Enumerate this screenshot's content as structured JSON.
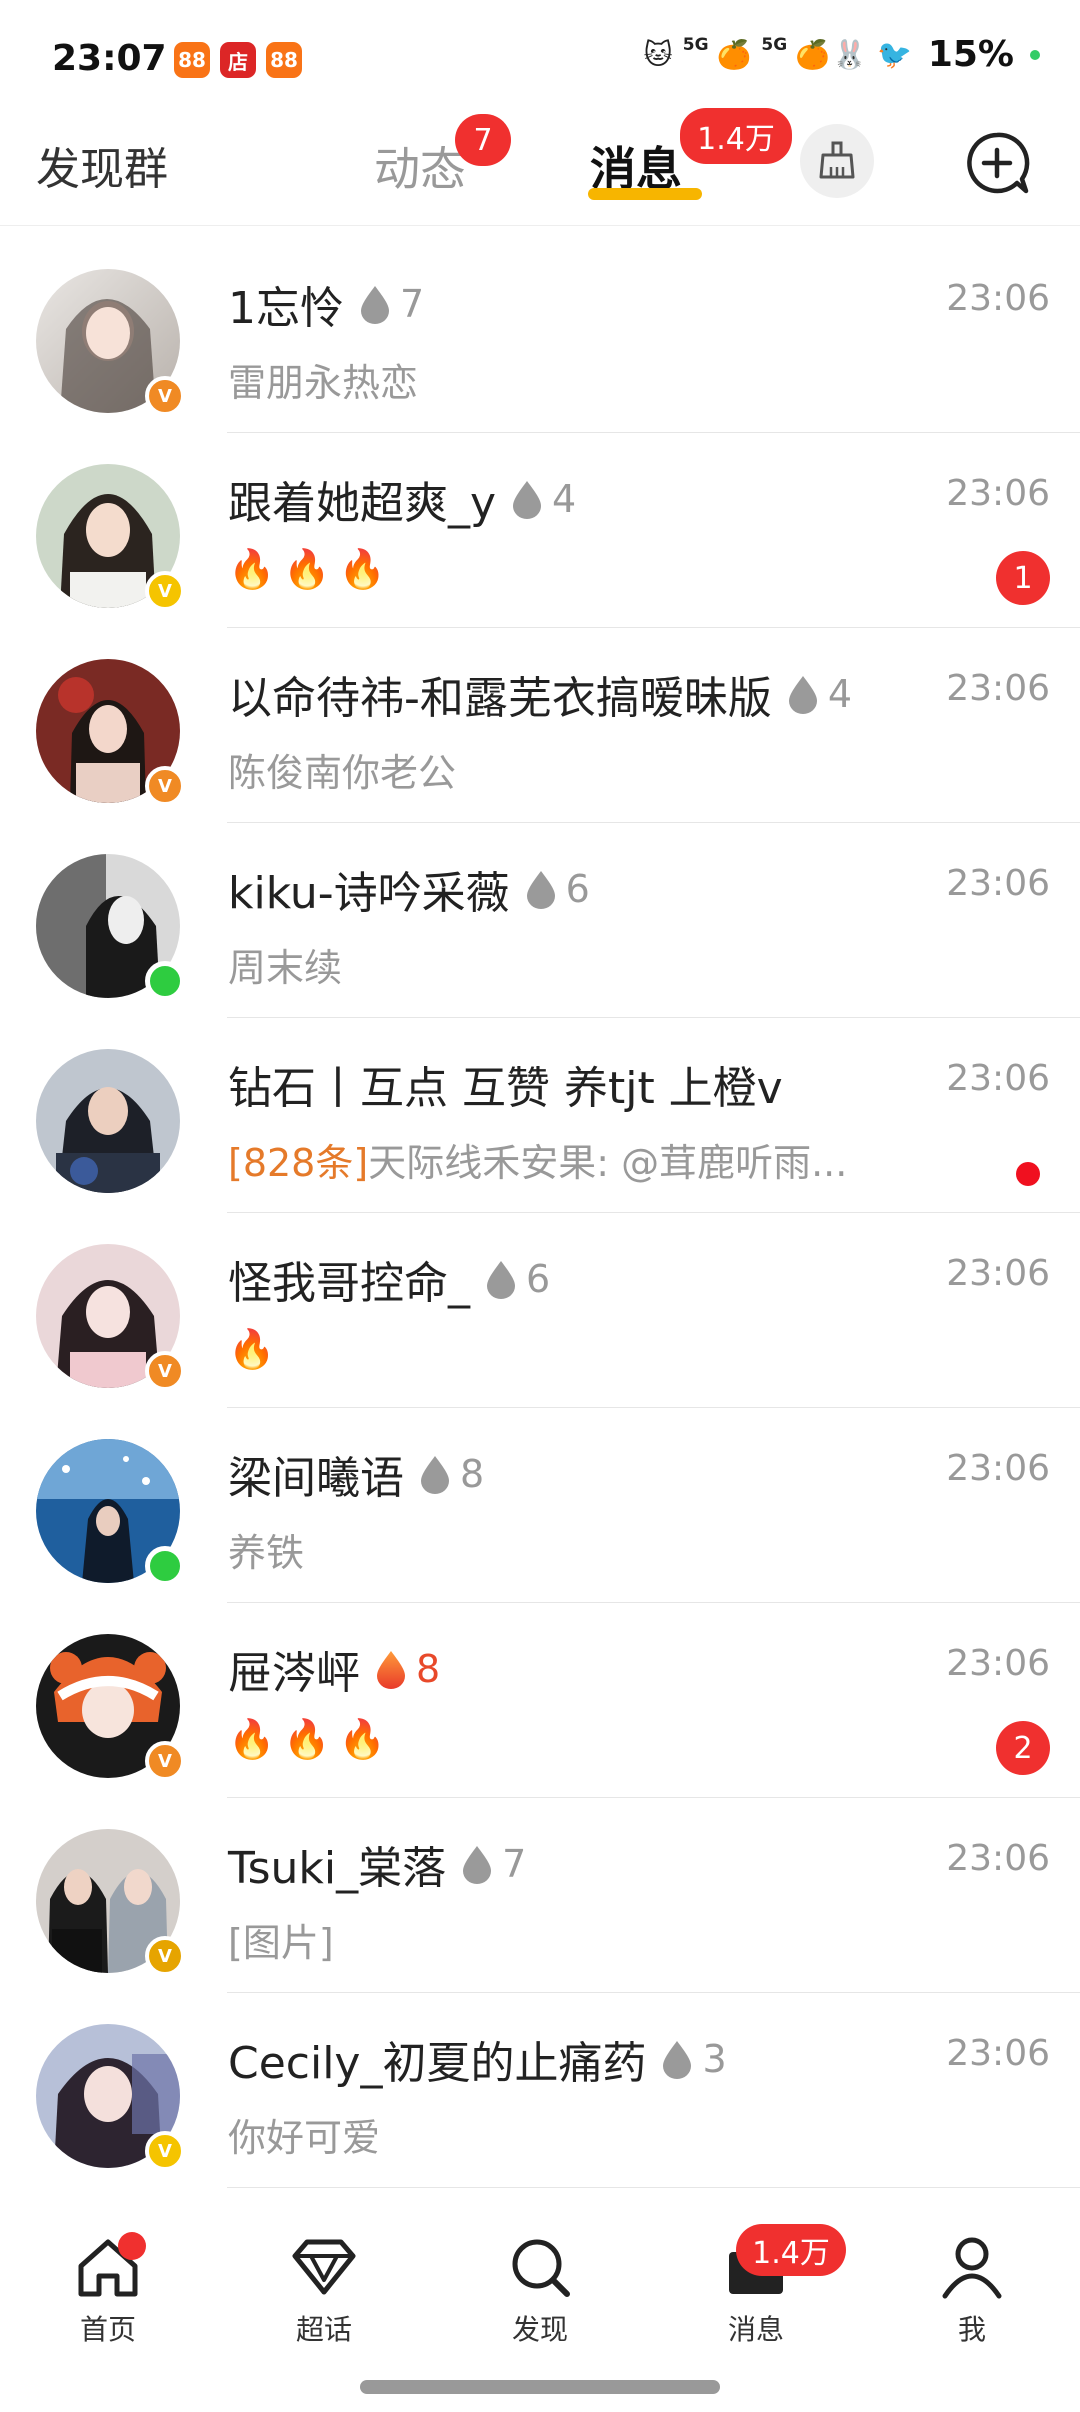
{
  "status_bar": {
    "time": "23:07",
    "app_badges": [
      {
        "text": "88",
        "color": "#f97316"
      },
      {
        "text": "店",
        "color": "#dc2626"
      },
      {
        "text": "88",
        "color": "#f97316"
      }
    ],
    "signal_text": "5G",
    "signal_text_2": "5G",
    "battery": "15%",
    "battery_dot_color": "#33cc66"
  },
  "top_nav": {
    "discover_groups": "发现群",
    "dynamics": "动态",
    "dynamics_badge": "7",
    "messages": "消息",
    "messages_badge": "1.4万",
    "accent_color": "#f7b500"
  },
  "messages": [
    {
      "name": "1忘怜",
      "fire": "7",
      "fire_hot": false,
      "preview": "雷朋永热恋",
      "time": "23:06",
      "badge": "vip-orange",
      "unread": ""
    },
    {
      "name": "跟着她超爽_y",
      "fire": "4",
      "fire_hot": false,
      "preview": "🔥🔥🔥",
      "time": "23:06",
      "badge": "vip-yellow",
      "unread": "1"
    },
    {
      "name": "以命待祎-和露芜衣搞暧昧版",
      "fire": "4",
      "fire_hot": false,
      "preview": "陈俊南你老公",
      "time": "23:06",
      "badge": "vip-orange",
      "unread": ""
    },
    {
      "name": "kiku-诗吟采薇",
      "fire": "6",
      "fire_hot": false,
      "preview": "周末续",
      "time": "23:06",
      "badge": "online",
      "unread": ""
    },
    {
      "name": "钻石丨互点 互赞 养tjt 上橙v",
      "fire": "",
      "fire_hot": false,
      "count_tag": "[828条]",
      "preview": "天际线禾安果: @茸鹿听雨...",
      "time": "23:06",
      "badge": "none",
      "unread": "dot"
    },
    {
      "name": "怪我哥控命_",
      "fire": "6",
      "fire_hot": false,
      "preview": "🔥",
      "time": "23:06",
      "badge": "vip-orange",
      "unread": ""
    },
    {
      "name": "梁间曦语",
      "fire": "8",
      "fire_hot": false,
      "preview": "养铁",
      "time": "23:06",
      "badge": "online",
      "unread": ""
    },
    {
      "name": "屉涔岼",
      "fire": "8",
      "fire_hot": true,
      "preview": "🔥🔥🔥",
      "time": "23:06",
      "badge": "vip-orange",
      "unread": "2"
    },
    {
      "name": "Tsuki_棠落",
      "fire": "7",
      "fire_hot": false,
      "preview": "[图片]",
      "time": "23:06",
      "badge": "vip-gold",
      "unread": ""
    },
    {
      "name": "Cecily_初夏的止痛药",
      "fire": "3",
      "fire_hot": false,
      "preview": "你好可爱",
      "time": "23:06",
      "badge": "vip-yellow",
      "unread": ""
    }
  ],
  "bottom_nav": {
    "home": "首页",
    "super_topic": "超话",
    "discover": "发现",
    "messages": "消息",
    "messages_badge": "1.4万",
    "me": "我"
  }
}
